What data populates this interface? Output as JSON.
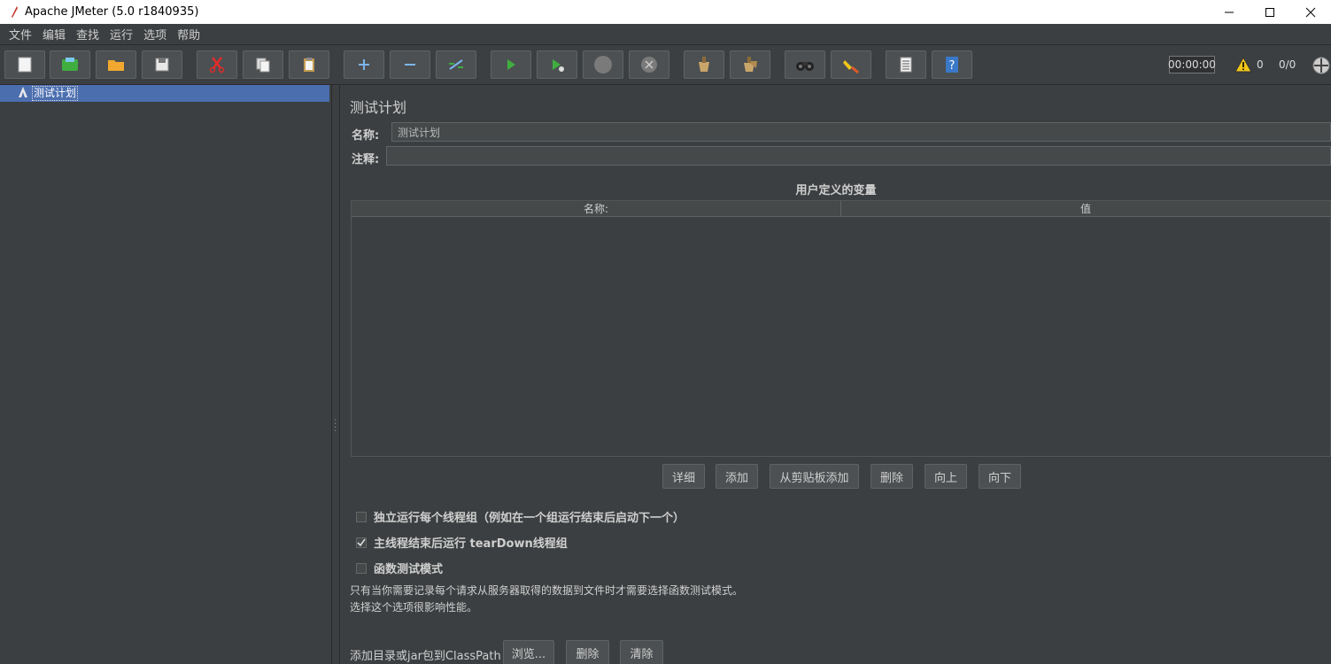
{
  "window": {
    "title": "Apache JMeter (5.0 r1840935)"
  },
  "menu": [
    "文件",
    "编辑",
    "查找",
    "运行",
    "选项",
    "帮助"
  ],
  "toolbar": {
    "timer": "00:00:00",
    "warning_count": "0",
    "thread_count": "0/0"
  },
  "tree": {
    "root_label": "测试计划"
  },
  "plan": {
    "title": "测试计划",
    "name_label": "名称:",
    "name_value": "测试计划",
    "comment_label": "注释:",
    "comment_value": "",
    "vars_title": "用户定义的变量",
    "columns": [
      "名称:",
      "值"
    ],
    "rows": []
  },
  "actions": {
    "detail": "详细",
    "add": "添加",
    "add_clipboard": "从剪贴板添加",
    "delete": "删除",
    "up": "向上",
    "down": "向下"
  },
  "options": [
    {
      "label": "独立运行每个线程组（例如在一个组运行结束后启动下一个）",
      "checked": false
    },
    {
      "label": "主线程结束后运行 tearDown线程组",
      "checked": true
    },
    {
      "label": "函数测试模式",
      "checked": false
    }
  ],
  "notes": {
    "line1": "只有当你需要记录每个请求从服务器取得的数据到文件时才需要选择函数测试模式。",
    "line2": "选择这个选项很影响性能。"
  },
  "classpath": {
    "label": "添加目录或jar包到ClassPath",
    "browse": "浏览...",
    "delete": "删除",
    "clear": "清除"
  },
  "colors": {
    "selection": "#4b6eaf",
    "background": "#3c3f41",
    "run_green": "#3fae3f",
    "warning_yellow": "#f0c419"
  }
}
